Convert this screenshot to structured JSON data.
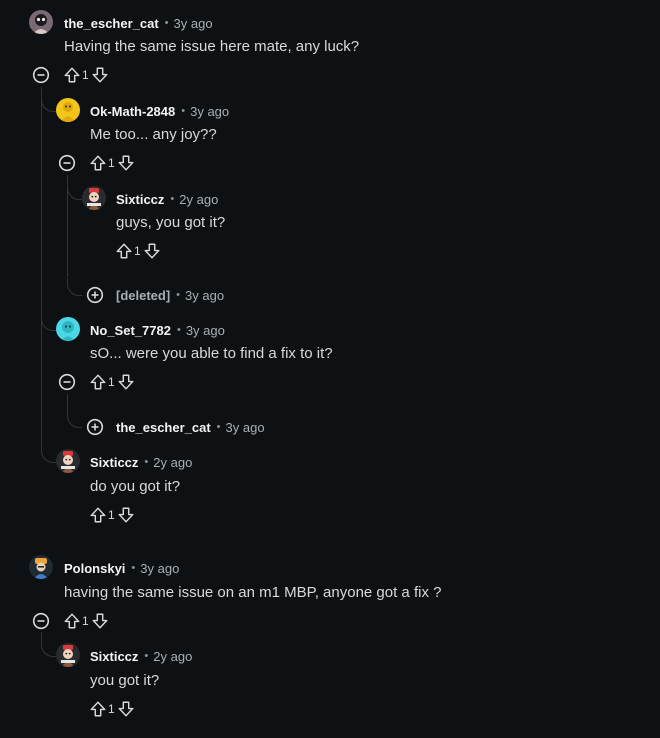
{
  "comments": {
    "c1": {
      "author": "the_escher_cat",
      "sep": "•",
      "time": "3y ago",
      "text": "Having the same issue here mate, any luck?",
      "votes": "1"
    },
    "c2": {
      "author": "Ok-Math-2848",
      "sep": "•",
      "time": "3y ago",
      "text": "Me too... any joy??",
      "votes": "1"
    },
    "c3": {
      "author": "Sixticcz",
      "sep": "•",
      "time": "2y ago",
      "text": "guys, you got it?",
      "votes": "1"
    },
    "c4": {
      "author": "[deleted]",
      "sep": "•",
      "time": "3y ago"
    },
    "c5": {
      "author": "No_Set_7782",
      "sep": "•",
      "time": "3y ago",
      "text": "sO... were you able to find a fix to it?",
      "votes": "1"
    },
    "c6": {
      "author": "the_escher_cat",
      "sep": "•",
      "time": "3y ago"
    },
    "c7": {
      "author": "Sixticcz",
      "sep": "•",
      "time": "2y ago",
      "text": "do you got it?",
      "votes": "1"
    },
    "c8": {
      "author": "Polonskyi",
      "sep": "•",
      "time": "3y ago",
      "text": "having the same issue on an m1 MBP, anyone got a fix ?",
      "votes": "1"
    },
    "c9": {
      "author": "Sixticcz",
      "sep": "•",
      "time": "2y ago",
      "text": "you got it?",
      "votes": "1"
    }
  },
  "colors": {
    "background": "#0e1113",
    "thread_line": "#343536",
    "text": "#d7dadc",
    "meta": "#a9afb3"
  },
  "icons": {
    "upvote": "upvote-arrow-icon",
    "downvote": "downvote-arrow-icon",
    "collapse": "minus-circle-icon",
    "expand": "plus-circle-icon"
  }
}
